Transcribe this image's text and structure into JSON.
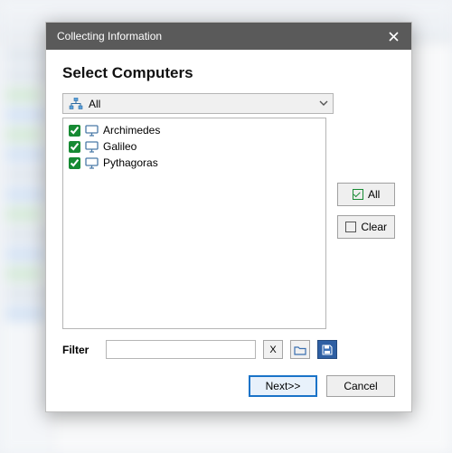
{
  "window": {
    "title": "Collecting Information",
    "heading": "Select Computers"
  },
  "dropdown": {
    "selected": "All"
  },
  "computers": [
    {
      "label": "Archimedes",
      "checked": true
    },
    {
      "label": "Galileo",
      "checked": true
    },
    {
      "label": "Pythagoras",
      "checked": true
    }
  ],
  "side": {
    "all": "All",
    "clear": "Clear"
  },
  "filter": {
    "label": "Filter",
    "value": "",
    "placeholder": "",
    "clear": "X"
  },
  "footer": {
    "next": "Next>>",
    "cancel": "Cancel"
  },
  "colors": {
    "accent": "#1a73c8",
    "check": "#168a33",
    "monitor": "#4a7aa8"
  }
}
